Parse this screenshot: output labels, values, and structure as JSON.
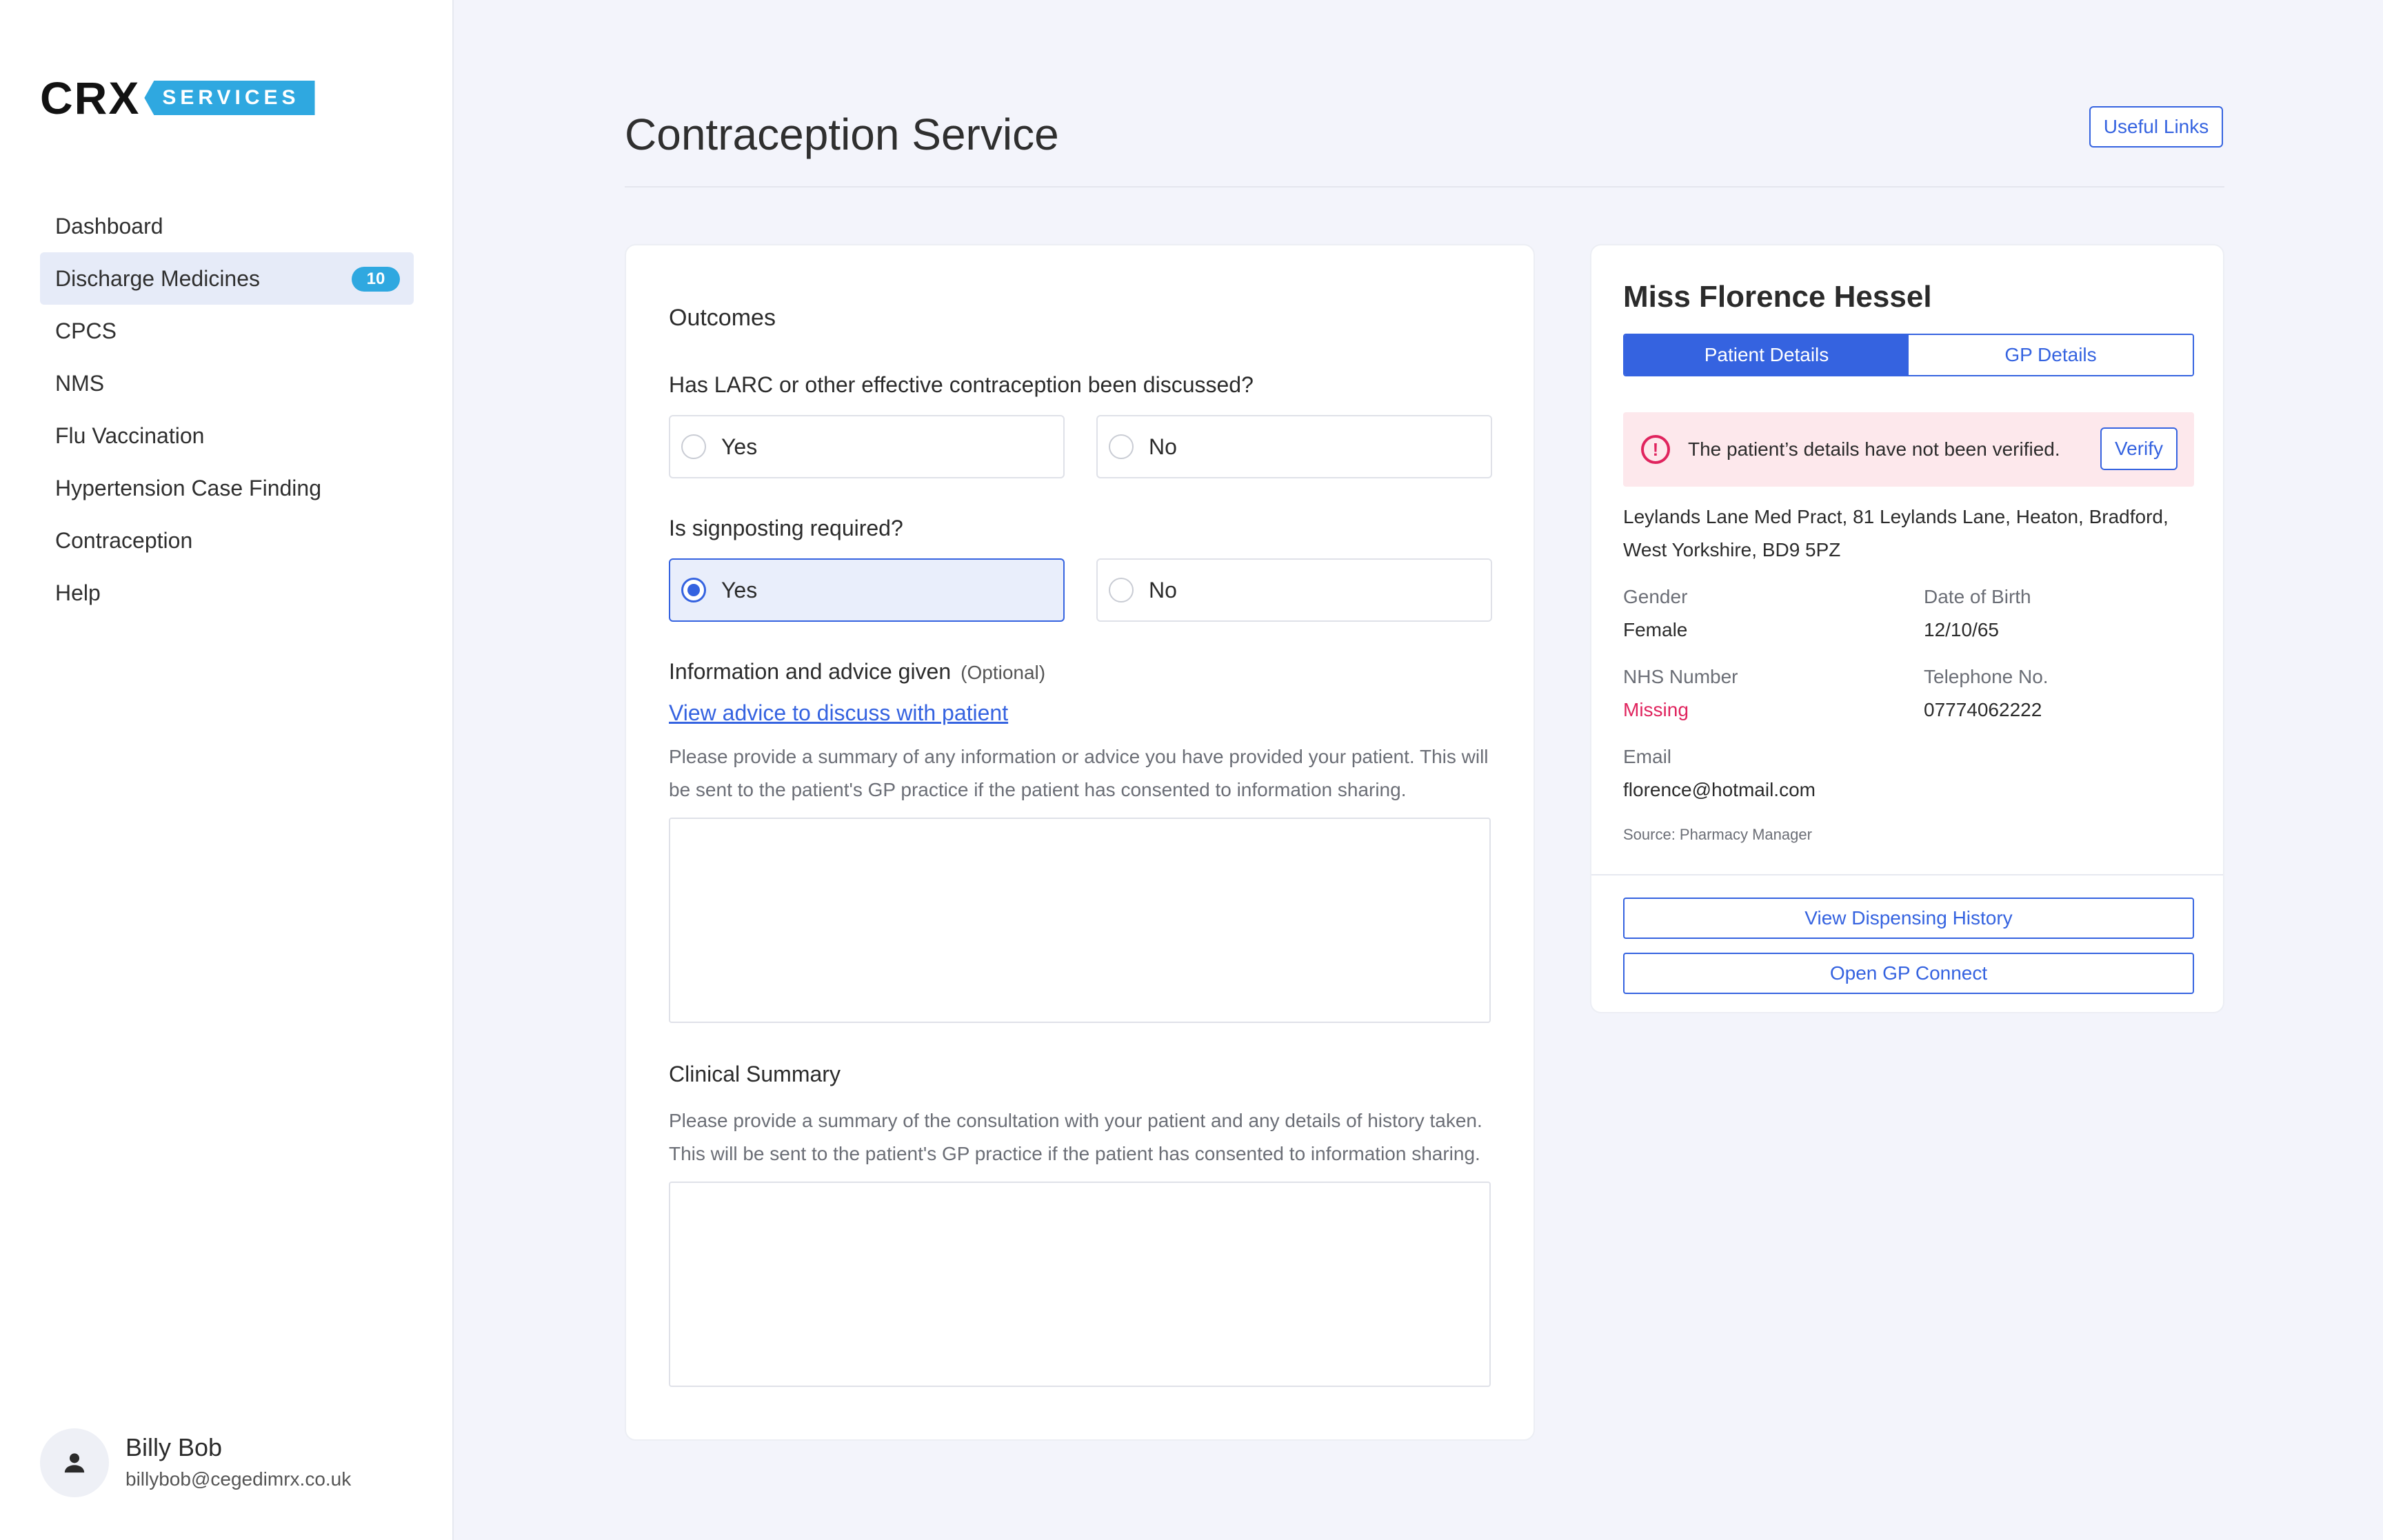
{
  "sidebar": {
    "logo": {
      "primary": "CRX",
      "secondary": "SERVICES"
    },
    "nav": [
      {
        "label": "Dashboard"
      },
      {
        "label": "Discharge Medicines",
        "badge": "10",
        "active": true
      },
      {
        "label": "CPCS"
      },
      {
        "label": "NMS"
      },
      {
        "label": "Flu Vaccination"
      },
      {
        "label": "Hypertension Case Finding"
      },
      {
        "label": "Contraception"
      },
      {
        "label": "Help"
      }
    ],
    "user": {
      "name": "Billy Bob",
      "email": "billybob@cegedimrx.co.uk",
      "avatar_icon": "person-icon"
    }
  },
  "header": {
    "title": "Contraception Service",
    "useful_links_label": "Useful Links"
  },
  "form": {
    "outcomes_heading": "Outcomes",
    "q1": {
      "label": "Has LARC or other effective contraception been discussed?",
      "yes": "Yes",
      "no": "No",
      "selected": null
    },
    "q2": {
      "label": "Is signposting required?",
      "yes": "Yes",
      "no": "No",
      "selected": "Yes"
    },
    "info": {
      "label": "Information and advice given",
      "optional": "(Optional)",
      "link": "View advice to discuss with patient",
      "helper_line1": "Please provide a summary of any information or advice you have provided your patient. This will",
      "helper_line2": "be sent to the patient's GP practice if the patient has consented to information sharing.",
      "value": ""
    },
    "clinical": {
      "label": "Clinical Summary",
      "helper_line1": "Please provide a summary of the consultation with your patient and any details of history taken.",
      "helper_line2": "This will be sent to the patient's GP practice if the patient has consented to information sharing.",
      "value": ""
    }
  },
  "patient": {
    "name": "Miss Florence Hessel",
    "tabs": [
      {
        "label": "Patient Details",
        "active": true
      },
      {
        "label": "GP Details",
        "active": false
      }
    ],
    "alert": {
      "text": "The patient’s details have not been verified.",
      "button": "Verify",
      "icon": "exclamation-circle-icon",
      "color": "#e0245e"
    },
    "address_line1": "Leylands Lane Med Pract, 81 Leylands Lane, Heaton, Bradford,",
    "address_line2": "West Yorkshire, BD9 5PZ",
    "gender_label": "Gender",
    "gender": "Female",
    "dob_label": "Date of Birth",
    "dob": "12/10/65",
    "nhs_label": "NHS Number",
    "nhs": "Missing",
    "phone_label": "Telephone No.",
    "phone": "07774062222",
    "email_label": "Email",
    "email": "florence@hotmail.com",
    "source": "Source: Pharmacy Manager",
    "dispensing_button": "View Dispensing History",
    "gp_connect_button": "Open GP Connect"
  },
  "colors": {
    "accent": "#3563e0",
    "badge": "#2fa8e0",
    "alert_bg": "#fde8ec",
    "danger": "#e0245e",
    "page_bg": "#f3f4fb"
  }
}
